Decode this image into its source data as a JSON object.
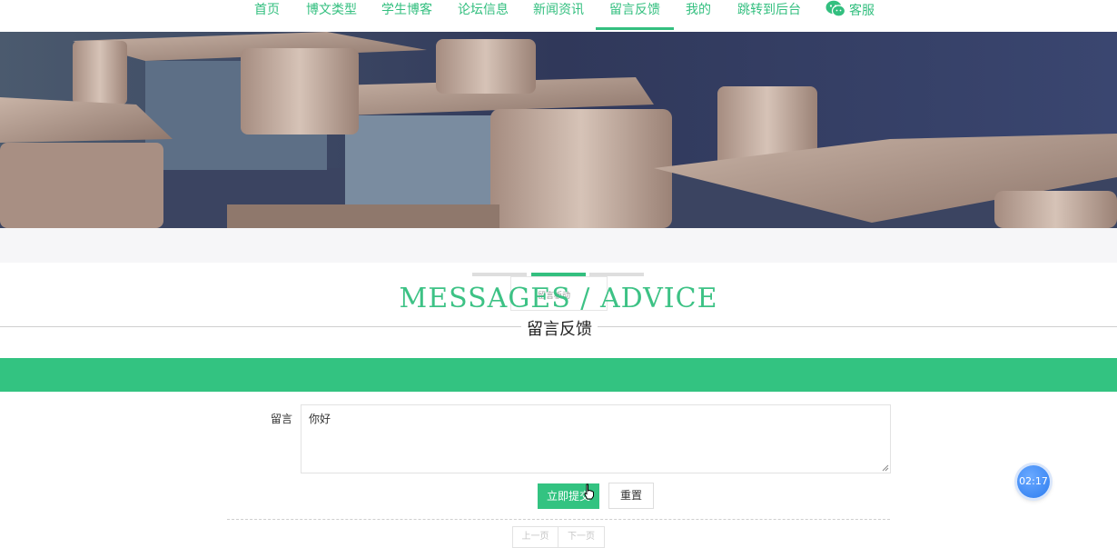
{
  "nav": {
    "items": [
      "首页",
      "博文类型",
      "学生博客",
      "论坛信息",
      "新闻资讯",
      "留言反馈",
      "我的",
      "跳转到后台"
    ],
    "active": "留言反馈",
    "service_label": "客服",
    "accent_color": "#33bf7f"
  },
  "icons": {
    "service": "wechat-icon"
  },
  "section": {
    "ghost_label": "留言板动",
    "title_en": "MESSAGES / ADVICE",
    "title_cn": "留言反馈"
  },
  "form": {
    "label": "留言",
    "message_value": "你好",
    "submit_label": "立即提交",
    "reset_label": "重置"
  },
  "pagination": {
    "prev": "上一页",
    "next": "下一页"
  },
  "timer": "02:17"
}
